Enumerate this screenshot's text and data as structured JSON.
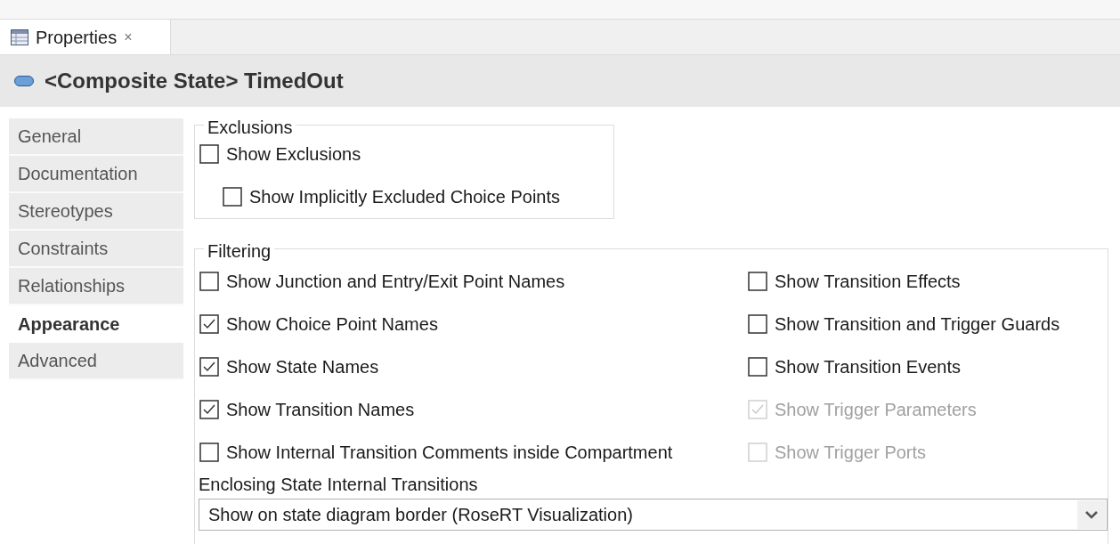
{
  "view_tab": {
    "label": "Properties",
    "close": "×"
  },
  "header": {
    "title": "<Composite State> TimedOut"
  },
  "sidebar": {
    "items": [
      {
        "label": "General",
        "selected": false
      },
      {
        "label": "Documentation",
        "selected": false
      },
      {
        "label": "Stereotypes",
        "selected": false
      },
      {
        "label": "Constraints",
        "selected": false
      },
      {
        "label": "Relationships",
        "selected": false
      },
      {
        "label": "Appearance",
        "selected": true
      },
      {
        "label": "Advanced",
        "selected": false
      }
    ]
  },
  "exclusions": {
    "title": "Exclusions",
    "options": [
      {
        "label": "Show Exclusions",
        "checked": false,
        "disabled": false,
        "nested": false
      },
      {
        "label": "Show Implicitly Excluded Choice Points",
        "checked": false,
        "disabled": false,
        "nested": true
      }
    ]
  },
  "filtering": {
    "title": "Filtering",
    "left_options": [
      {
        "label": "Show Junction and Entry/Exit Point Names",
        "checked": false,
        "disabled": false
      },
      {
        "label": "Show Choice Point Names",
        "checked": true,
        "disabled": false
      },
      {
        "label": "Show State Names",
        "checked": true,
        "disabled": false
      },
      {
        "label": "Show Transition Names",
        "checked": true,
        "disabled": false
      },
      {
        "label": "Show Internal Transition Comments inside Compartment",
        "checked": false,
        "disabled": false
      }
    ],
    "right_options": [
      {
        "label": "Show Transition Effects",
        "checked": false,
        "disabled": false
      },
      {
        "label": "Show Transition and Trigger Guards",
        "checked": false,
        "disabled": false
      },
      {
        "label": "Show Transition Events",
        "checked": false,
        "disabled": false
      },
      {
        "label": "Show Trigger Parameters",
        "checked": true,
        "disabled": true
      },
      {
        "label": "Show Trigger Ports",
        "checked": false,
        "disabled": true
      }
    ],
    "dropdown": {
      "label": "Enclosing State Internal Transitions",
      "value": "Show on state diagram border (RoseRT Visualization)"
    }
  }
}
